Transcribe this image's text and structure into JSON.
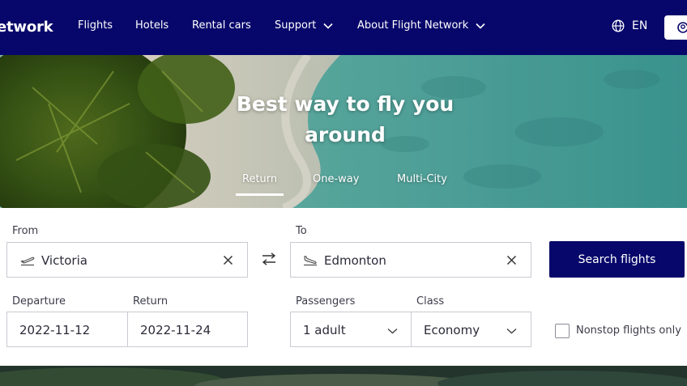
{
  "brand": {
    "name": "etwork"
  },
  "nav": {
    "items": [
      {
        "label": "Flights"
      },
      {
        "label": "Hotels"
      },
      {
        "label": "Rental cars"
      },
      {
        "label": "Support"
      },
      {
        "label": "About Flight Network"
      }
    ],
    "language": "EN"
  },
  "hero": {
    "title_line1": "Best way to fly you",
    "title_line2": "around",
    "trip_tabs": [
      {
        "label": "Return",
        "active": true
      },
      {
        "label": "One-way",
        "active": false
      },
      {
        "label": "Multi-City",
        "active": false
      }
    ]
  },
  "search": {
    "from_label": "From",
    "from_value": "Victoria",
    "to_label": "To",
    "to_value": "Edmonton",
    "departure_label": "Departure",
    "departure_value": "2022-11-12",
    "return_label": "Return",
    "return_value": "2022-11-24",
    "passengers_label": "Passengers",
    "passengers_value": "1 adult",
    "class_label": "Class",
    "class_value": "Economy",
    "nonstop_label": "Nonstop flights only",
    "nonstop_checked": false,
    "search_button": "Search flights"
  },
  "colors": {
    "brand_navy": "#07076b",
    "field_border": "#c9cbd2",
    "sea_teal": "#4aa7a1"
  }
}
